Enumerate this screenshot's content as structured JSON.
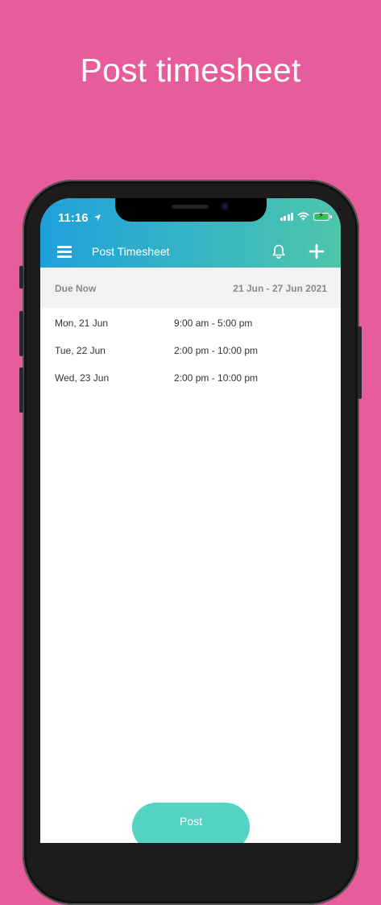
{
  "headline": "Post timesheet",
  "status_bar": {
    "time": "11:16",
    "icons": [
      "location-arrow-icon",
      "signal-icon",
      "wifi-icon",
      "battery-charging-icon"
    ]
  },
  "header": {
    "title": "Post Timesheet",
    "icons": [
      "menu-icon",
      "bell-icon",
      "plus-icon"
    ]
  },
  "period": {
    "label": "Due Now",
    "range": "21 Jun - 27 Jun 2021"
  },
  "shifts": [
    {
      "day": "Mon, 21 Jun",
      "hours": "9:00 am - 5:00 pm"
    },
    {
      "day": "Tue, 22 Jun",
      "hours": "2:00 pm - 10:00 pm"
    },
    {
      "day": "Wed, 23 Jun",
      "hours": "2:00 pm - 10:00 pm"
    }
  ],
  "post_button": "Post",
  "colors": {
    "background": "#e75d9c",
    "header_gradient_start": "#1ea0dc",
    "header_gradient_end": "#4ec6a9",
    "button": "#54d3c3",
    "battery_fill": "#33c24a"
  }
}
